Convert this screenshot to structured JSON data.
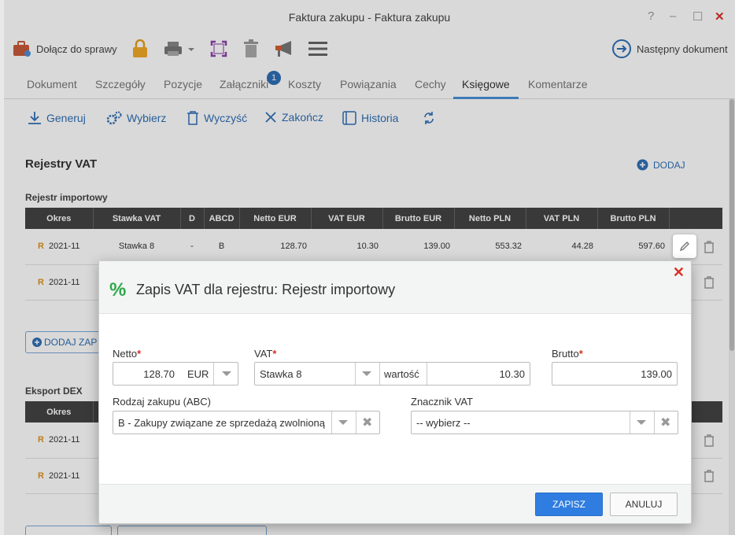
{
  "window": {
    "title": "Faktura zakupu - Faktura zakupu",
    "help": "?",
    "minimize": "–",
    "maximize": "☐",
    "close": "✕"
  },
  "toolbar": {
    "attach_label": "Dołącz do sprawy",
    "next_label": "Następny dokument"
  },
  "tabs": [
    {
      "label": "Dokument"
    },
    {
      "label": "Szczegóły"
    },
    {
      "label": "Pozycje"
    },
    {
      "label": "Załączniki"
    },
    {
      "label": "Koszty"
    },
    {
      "label": "Powiązania"
    },
    {
      "label": "Cechy"
    },
    {
      "label": "Księgowe"
    },
    {
      "label": "Komentarze"
    }
  ],
  "attachments_badge": "1",
  "actions": {
    "generate": "Generuj",
    "select": "Wybierz",
    "clear": "Wyczyść",
    "finish": "Zakończ",
    "history": "Historia"
  },
  "vat_section": {
    "title": "Rejestry VAT",
    "add_label": "DODAJ"
  },
  "import_register": {
    "title": "Rejestr importowy",
    "columns": [
      "Okres",
      "Stawka VAT",
      "D",
      "ABCD",
      "Netto EUR",
      "VAT EUR",
      "Brutto EUR",
      "Netto PLN",
      "VAT PLN",
      "Brutto PLN"
    ],
    "rows": [
      {
        "mark": "R",
        "period": "2021-11",
        "rate": "Stawka 8",
        "d": "-",
        "abcd": "B",
        "net_eur": "128.70",
        "vat_eur": "10.30",
        "gross_eur": "139.00",
        "net_pln": "553.32",
        "vat_pln": "44.28",
        "gross_pln": "597.60"
      },
      {
        "mark": "R",
        "period": "2021-11"
      }
    ],
    "add_entry": "DODAJ ZAP"
  },
  "dex_export": {
    "title": "Eksport DEX",
    "columns": [
      "Okres"
    ],
    "rows": [
      {
        "mark": "R",
        "period": "2021-11"
      },
      {
        "mark": "R",
        "period": "2021-11"
      }
    ]
  },
  "modal": {
    "title": "Zapis VAT dla rejestru: Rejestr importowy",
    "icon_glyph": "%",
    "close_glyph": "✕",
    "net_label": "Netto",
    "net_value": "128.70",
    "currency": "EUR",
    "vat_label": "VAT",
    "vat_rate": "Stawka 8",
    "vat_amount_label": "wartość",
    "vat_amount": "10.30",
    "gross_label": "Brutto",
    "gross_value": "139.00",
    "purchase_type_label": "Rodzaj zakupu (ABC)",
    "purchase_type_value": "B - Zakupy związane ze sprzedażą zwolnioną",
    "vat_marker_label": "Znacznik VAT",
    "vat_marker_value": "-- wybierz --",
    "save": "ZAPISZ",
    "cancel": "ANULUJ"
  },
  "colors": {
    "accent": "#2f7de0",
    "required": "#d93025",
    "period_mark": "#e09420",
    "header_bg": "#444444"
  }
}
